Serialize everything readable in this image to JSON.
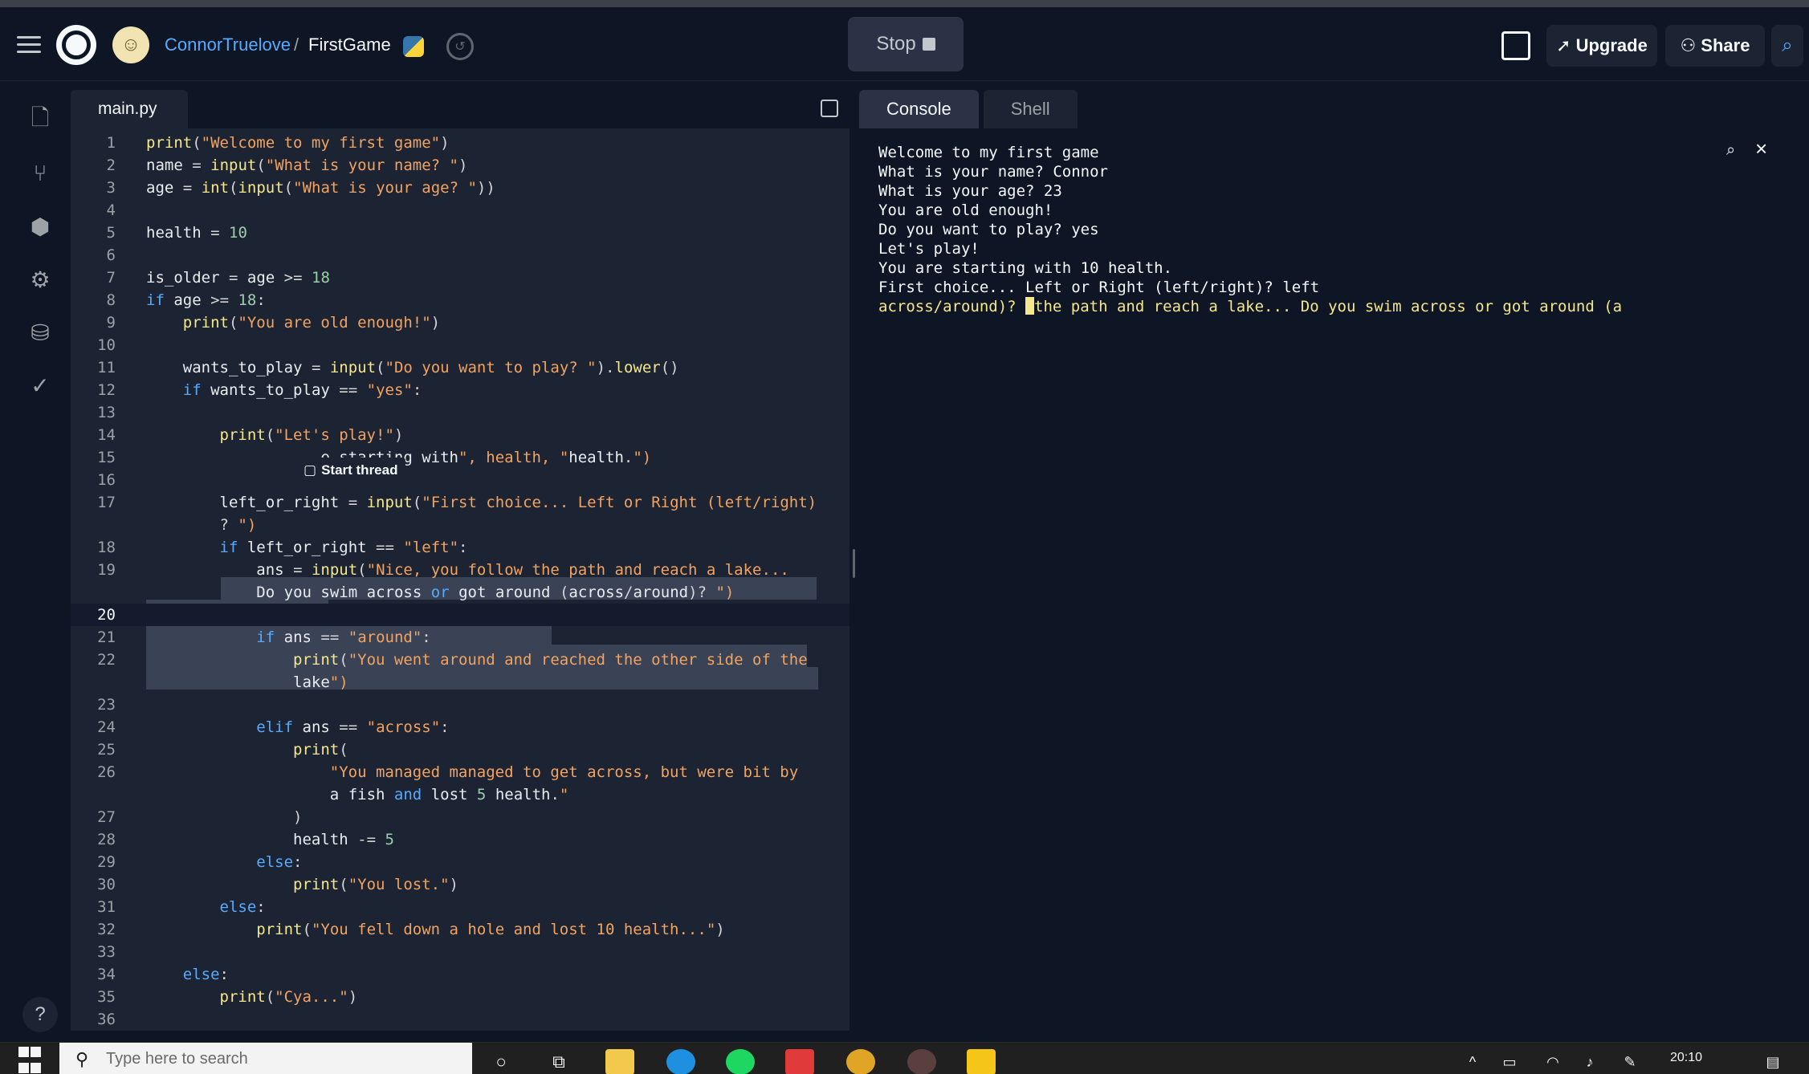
{
  "header": {
    "user": "ConnorTruelove",
    "separator": "/",
    "repl_name": "FirstGame",
    "stop_label": "Stop",
    "upgrade_label": "Upgrade",
    "share_label": "Share"
  },
  "editor": {
    "file_name": "main.py",
    "thread_tip": "Start thread",
    "lines": [
      {
        "n": "1",
        "t": "print(\"Welcome to my first game\")"
      },
      {
        "n": "2",
        "t": "name = input(\"What is your name? \")"
      },
      {
        "n": "3",
        "t": "age = int(input(\"What is your age? \"))"
      },
      {
        "n": "4",
        "t": ""
      },
      {
        "n": "5",
        "t": "health = 10"
      },
      {
        "n": "6",
        "t": ""
      },
      {
        "n": "7",
        "t": "is_older = age >= 18"
      },
      {
        "n": "8",
        "t": "if age >= 18:"
      },
      {
        "n": "9",
        "t": "    print(\"You are old enough!\")"
      },
      {
        "n": "10",
        "t": ""
      },
      {
        "n": "11",
        "t": "    wants_to_play = input(\"Do you want to play? \").lower()"
      },
      {
        "n": "12",
        "t": "    if wants_to_play == \"yes\":"
      },
      {
        "n": "13",
        "t": ""
      },
      {
        "n": "14",
        "t": "        print(\"Let's play!\")"
      },
      {
        "n": "15",
        "t": "                   e starting with\", health, \"health.\")"
      },
      {
        "n": "16",
        "t": ""
      },
      {
        "n": "17",
        "t": "        left_or_right = input(\"First choice... Left or Right (left/right)"
      },
      {
        "n": "",
        "t": "        ? \")"
      },
      {
        "n": "18",
        "t": "        if left_or_right == \"left\":"
      },
      {
        "n": "19",
        "t": "            ans = input(\"Nice, you follow the path and reach a lake..."
      },
      {
        "n": "",
        "t": "            Do you swim across or got around (across/around)? \")"
      },
      {
        "n": "20",
        "t": ""
      },
      {
        "n": "21",
        "t": "            if ans == \"around\":"
      },
      {
        "n": "22",
        "t": "                print(\"You went around and reached the other side of the"
      },
      {
        "n": "",
        "t": "                lake\")"
      },
      {
        "n": "23",
        "t": ""
      },
      {
        "n": "24",
        "t": "            elif ans == \"across\":"
      },
      {
        "n": "25",
        "t": "                print("
      },
      {
        "n": "26",
        "t": "                    \"You managed managed to get across, but were bit by"
      },
      {
        "n": "",
        "t": "                    a fish and lost 5 health.\""
      },
      {
        "n": "27",
        "t": "                )"
      },
      {
        "n": "28",
        "t": "                health -= 5"
      },
      {
        "n": "29",
        "t": "            else:"
      },
      {
        "n": "30",
        "t": "                print(\"You lost.\")"
      },
      {
        "n": "31",
        "t": "        else:"
      },
      {
        "n": "32",
        "t": "            print(\"You fell down a hole and lost 10 health...\")"
      },
      {
        "n": "33",
        "t": ""
      },
      {
        "n": "34",
        "t": "    else:"
      },
      {
        "n": "35",
        "t": "        print(\"Cya...\")"
      },
      {
        "n": "36",
        "t": ""
      }
    ]
  },
  "console": {
    "tabs": [
      "Console",
      "Shell"
    ],
    "output": [
      "Welcome to my first game",
      "What is your name? Connor",
      "What is your age? 23",
      "You are old enough!",
      "Do you want to play? yes",
      "Let's play!",
      "You are starting with 10 health.",
      "First choice... Left or Right (left/right)? left"
    ],
    "prompt_before_cursor": "across/around)? ",
    "prompt_after_cursor": "the path and reach a lake... Do you swim across or got around (a"
  },
  "taskbar": {
    "search_placeholder": "Type here to search",
    "time": "20:10"
  },
  "colors": {
    "background": "#0e1525",
    "panel": "#1c2333",
    "accent": "#57abff",
    "string": "#f2a35f",
    "function": "#f5e78b",
    "number": "#9ccfab"
  }
}
